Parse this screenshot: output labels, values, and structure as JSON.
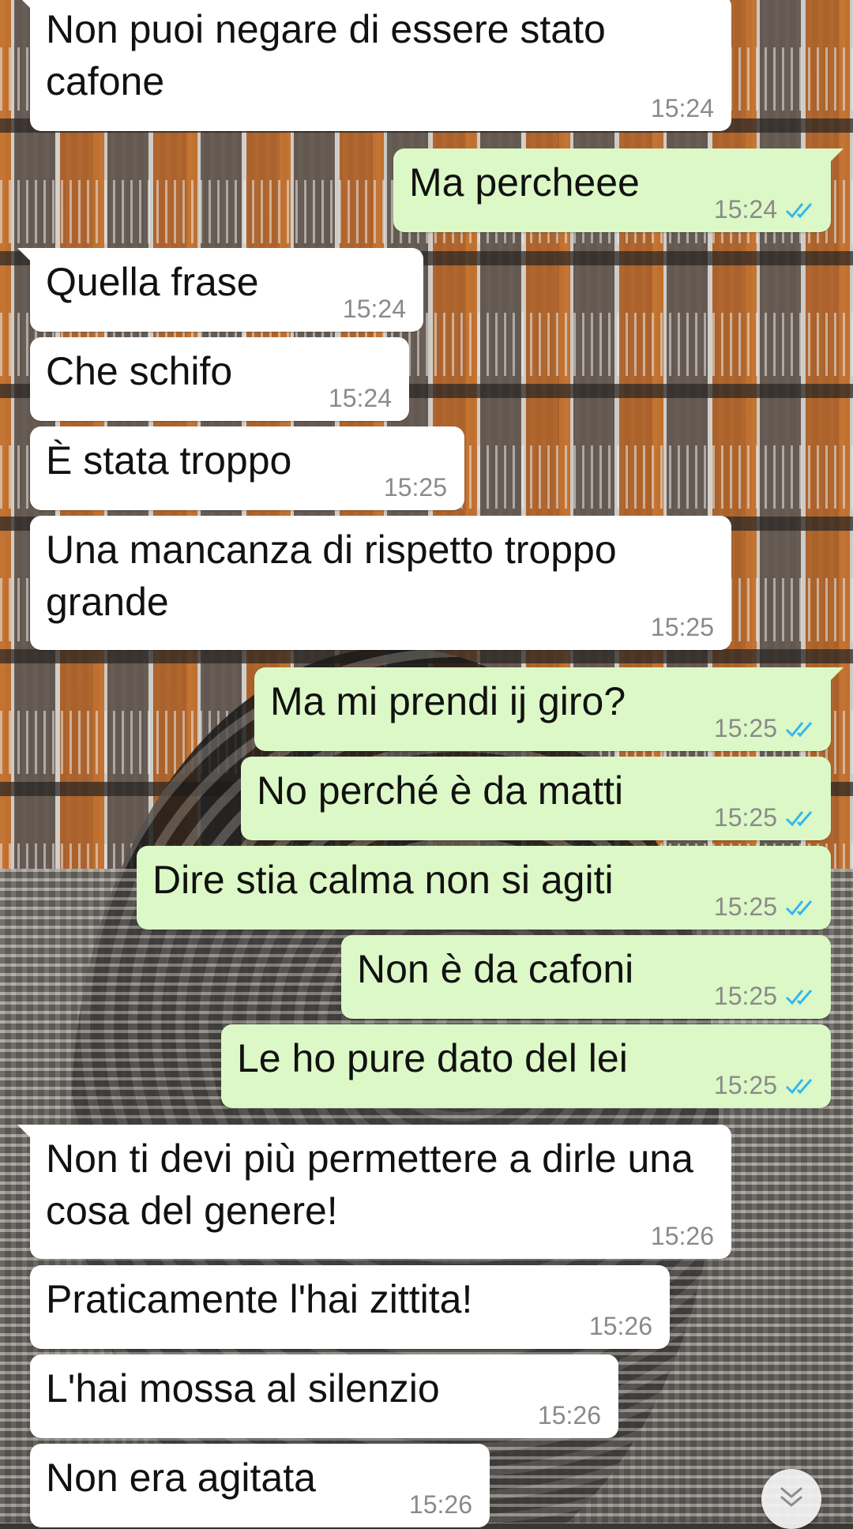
{
  "messages": [
    {
      "dir": "in",
      "text": "Non puoi negare di essere stato cafone",
      "time": "15:24"
    },
    {
      "dir": "out",
      "text": "Ma percheee",
      "time": "15:24",
      "status": "read"
    },
    {
      "dir": "in",
      "text": "Quella frase",
      "time": "15:24"
    },
    {
      "dir": "in",
      "text": "Che schifo",
      "time": "15:24"
    },
    {
      "dir": "in",
      "text": "È stata troppo",
      "time": "15:25"
    },
    {
      "dir": "in",
      "text": "Una mancanza di rispetto troppo grande",
      "time": "15:25"
    },
    {
      "dir": "out",
      "text": "Ma mi prendi ij giro?",
      "time": "15:25",
      "status": "read"
    },
    {
      "dir": "out",
      "text": "No perché è da matti",
      "time": "15:25",
      "status": "read"
    },
    {
      "dir": "out",
      "text": "Dire stia calma non si agiti",
      "time": "15:25",
      "status": "read"
    },
    {
      "dir": "out",
      "text": "Non è da cafoni",
      "time": "15:25",
      "status": "read"
    },
    {
      "dir": "out",
      "text": "Le ho pure dato del lei",
      "time": "15:25",
      "status": "read"
    },
    {
      "dir": "in",
      "text": "Non ti devi più permettere a dirle una cosa del genere!",
      "time": "15:26"
    },
    {
      "dir": "in",
      "text": "Praticamente l'hai zittita!",
      "time": "15:26"
    },
    {
      "dir": "in",
      "text": "L'hai mossa al silenzio",
      "time": "15:26"
    },
    {
      "dir": "in",
      "text": "Non era agitata",
      "time": "15:26"
    }
  ],
  "colors": {
    "incoming_bubble": "#ffffff",
    "outgoing_bubble": "#dcf8c6",
    "timestamp": "#8a8a8a",
    "read_ticks": "#34b7f1"
  },
  "icons": {
    "read_receipt": "double-check-icon",
    "scroll_down": "chevron-double-down-icon"
  }
}
